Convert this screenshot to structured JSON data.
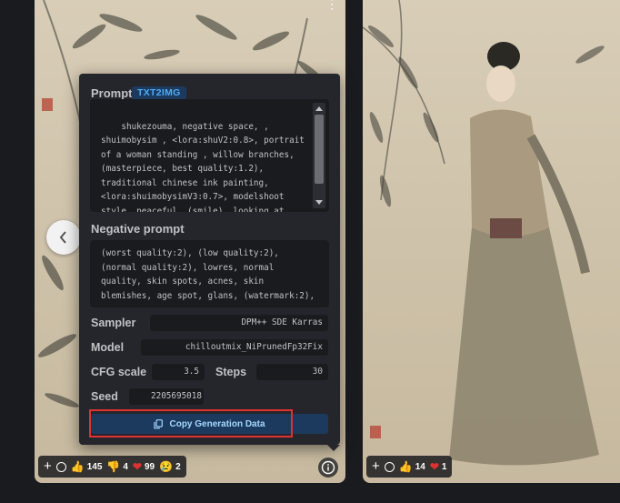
{
  "prompt_section": {
    "title": "Prompt",
    "badge": "TXT2IMG",
    "text": "shukezouma, negative space, , shuimobysim , <lora:shuV2:0.8>, portrait of a woman standing , willow branches, (masterpiece, best quality:1.2), traditional chinese ink painting, <lora:shuimobysimV3:0.7>, modelshoot style, peaceful, (smile), looking at viewer, wearing long hanfu, hanfu, song"
  },
  "negative_section": {
    "title": "Negative prompt",
    "text": "(worst quality:2), (low quality:2), (normal quality:2), lowres, normal quality, skin spots, acnes, skin blemishes, age spot, glans, (watermark:2),"
  },
  "params": {
    "sampler_label": "Sampler",
    "sampler_value": "DPM++ SDE Karras",
    "model_label": "Model",
    "model_value": "chilloutmix_NiPrunedFp32Fix",
    "cfg_label": "CFG scale",
    "cfg_value": "3.5",
    "steps_label": "Steps",
    "steps_value": "30",
    "seed_label": "Seed",
    "seed_value": "2205695018"
  },
  "copy_button": {
    "label": "Copy Generation Data",
    "icon": "copy-icon"
  },
  "left_reactions": {
    "thumbs_up": "145",
    "thumbs_down": "4",
    "heart": "99",
    "sad": "2"
  },
  "right_reactions": {
    "thumbs_up": "14",
    "heart": "1"
  },
  "colors": {
    "background": "#1a1b1e",
    "panel": "#25262b",
    "accent_blue": "#4dabf7",
    "button_bg": "#1c3a5e",
    "highlight_red": "#e03131"
  }
}
